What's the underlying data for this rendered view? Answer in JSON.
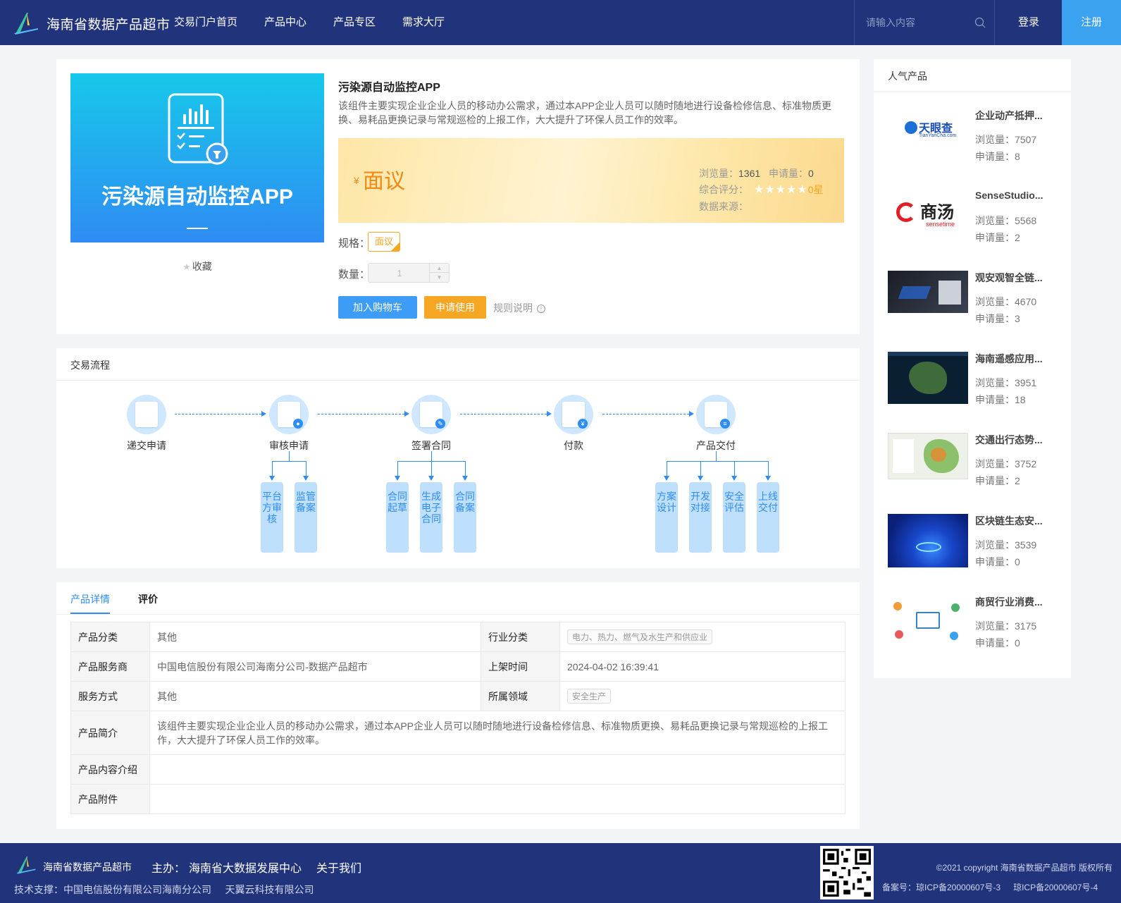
{
  "header": {
    "site_title": "海南省数据产品超市",
    "nav": [
      "交易门户首页",
      "产品中心",
      "产品专区",
      "需求大厅"
    ],
    "search_placeholder": "请输入内容",
    "login": "登录",
    "register": "注册"
  },
  "product": {
    "image_caption": "污染源自动监控APP",
    "favorite": "收藏",
    "title": "污染源自动监控APP",
    "description": "该组件主要实现企业企业人员的移动办公需求，通过本APP企业人员可以随时随地进行设备检修信息、标准物质更换、易耗品更换记录与常规巡检的上报工作，大大提升了环保人员工作的效率。",
    "price_symbol": "¥",
    "price": "面议",
    "views_label": "浏览量：",
    "views": "1361",
    "applies_label": "申请量：",
    "applies": "0",
    "rating_label": "综合评分：",
    "rating": "0星",
    "source_label": "数据来源：",
    "spec_label": "规格：",
    "spec_value": "面议",
    "qty_label": "数量：",
    "qty_value": "1",
    "add_cart": "加入购物车",
    "apply": "申请使用",
    "rules": "规则说明"
  },
  "process": {
    "title": "交易流程",
    "steps": [
      "递交申请",
      "审核申请",
      "签署合同",
      "付款",
      "产品交付"
    ],
    "sub_review": [
      "平台方审核",
      "监管备案"
    ],
    "sub_contract": [
      "合同起草",
      "生成电子合同",
      "合同备案"
    ],
    "sub_delivery": [
      "方案设计",
      "开发对接",
      "安全评估",
      "上线交付"
    ]
  },
  "detail": {
    "tab_detail": "产品详情",
    "tab_review": "评价",
    "rows": {
      "category_k": "产品分类",
      "category_v": "其他",
      "industry_k": "行业分类",
      "industry_v": "电力、热力、燃气及水生产和供应业",
      "provider_k": "产品服务商",
      "provider_v": "中国电信股份有限公司海南分公司-数据产品超市",
      "listed_k": "上架时间",
      "listed_v": "2024-04-02 16:39:41",
      "service_k": "服务方式",
      "service_v": "其他",
      "domain_k": "所属领域",
      "domain_v": "安全生产",
      "intro_k": "产品简介",
      "intro_v": "该组件主要实现企业企业人员的移动办公需求，通过本APP企业人员可以随时随地进行设备检修信息、标准物质更换、易耗品更换记录与常规巡检的上报工作，大大提升了环保人员工作的效率。",
      "content_k": "产品内容介绍",
      "content_v": "",
      "attach_k": "产品附件",
      "attach_v": ""
    }
  },
  "sidebar": {
    "title": "人气产品",
    "views_label": "浏览量：",
    "applies_label": "申请量：",
    "items": [
      {
        "name": "企业动产抵押...",
        "views": "7507",
        "applies": "8",
        "thumb_text": "天眼查",
        "thumb_sub": "TianYanCha.com"
      },
      {
        "name": "SenseStudio...",
        "views": "5568",
        "applies": "2",
        "thumb_text": "商汤",
        "thumb_sub": "sensetime"
      },
      {
        "name": "观安观智全链...",
        "views": "4670",
        "applies": "3"
      },
      {
        "name": "海南遥感应用...",
        "views": "3951",
        "applies": "18"
      },
      {
        "name": "交通出行态势...",
        "views": "3752",
        "applies": "2"
      },
      {
        "name": "区块链生态安...",
        "views": "3539",
        "applies": "0"
      },
      {
        "name": "商贸行业消费...",
        "views": "3175",
        "applies": "0"
      }
    ]
  },
  "footer": {
    "title": "海南省数据产品超市",
    "host_label": "主办：",
    "host": "海南省大数据发展中心",
    "about": "关于我们",
    "tech": "技术支撑：中国电信股份有限公司海南分公司     天翼云科技有限公司",
    "copyright": "©2021 copyright 海南省数据产品超市 版权所有",
    "icp1": "备案号：琼ICP备20000607号-3",
    "icp2": "琼ICP备20000607号-4"
  },
  "colors": {
    "header_bg": "#21337a",
    "accent": "#2f8cf3",
    "price": "#f08a14",
    "apply": "#f5a623",
    "register": "#3aa2ef"
  }
}
